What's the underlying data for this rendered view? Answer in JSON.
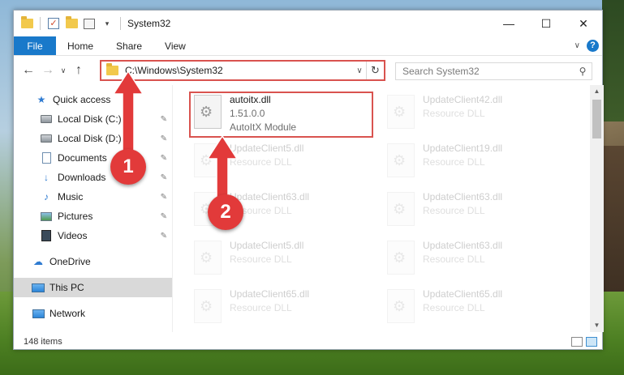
{
  "window": {
    "title": "System32",
    "controls": {
      "minimize": "—",
      "maximize": "☐",
      "close": "✕"
    }
  },
  "ribbon": {
    "tabs": [
      "File",
      "Home",
      "Share",
      "View"
    ]
  },
  "address": {
    "path": "C:\\Windows\\System32"
  },
  "search": {
    "placeholder": "Search System32"
  },
  "nav": {
    "items": [
      {
        "label": "Quick access",
        "icon": "star-icon",
        "pinned": false
      },
      {
        "label": "Local Disk (C:)",
        "icon": "drive-icon",
        "pinned": true
      },
      {
        "label": "Local Disk (D:)",
        "icon": "drive-icon",
        "pinned": true
      },
      {
        "label": "Documents",
        "icon": "document-icon",
        "pinned": true
      },
      {
        "label": "Downloads",
        "icon": "download-icon",
        "pinned": true
      },
      {
        "label": "Music",
        "icon": "music-icon",
        "pinned": true
      },
      {
        "label": "Pictures",
        "icon": "pictures-icon",
        "pinned": true
      },
      {
        "label": "Videos",
        "icon": "videos-icon",
        "pinned": true
      },
      {
        "label": "OneDrive",
        "icon": "cloud-icon",
        "pinned": false
      },
      {
        "label": "This PC",
        "icon": "computer-icon",
        "pinned": false,
        "selected": true
      },
      {
        "label": "Network",
        "icon": "network-icon",
        "pinned": false
      }
    ]
  },
  "files": [
    {
      "name": "autoitx.dll",
      "line2": "1.51.0.0",
      "line3": "AutoItX Module",
      "highlighted": true
    },
    {
      "name": "UpdateClient42.dll",
      "line2": "Resource DLL"
    },
    {
      "name": "UpdateClient5.dll",
      "line2": "Resource DLL"
    },
    {
      "name": "UpdateClient19.dll",
      "line2": "Resource DLL"
    },
    {
      "name": "UpdateClient63.dll",
      "line2": "Resource DLL"
    },
    {
      "name": "UpdateClient63.dll",
      "line2": "Resource DLL"
    },
    {
      "name": "UpdateClient5.dll",
      "line2": "Resource DLL"
    },
    {
      "name": "UpdateClient63.dll",
      "line2": "Resource DLL"
    },
    {
      "name": "UpdateClient65.dll",
      "line2": "Resource DLL"
    },
    {
      "name": "UpdateClient65.dll",
      "line2": "Resource DLL"
    }
  ],
  "status": {
    "item_count": "148 items"
  },
  "annotations": {
    "badge1": "1",
    "badge2": "2",
    "color": "#e23a3a"
  }
}
